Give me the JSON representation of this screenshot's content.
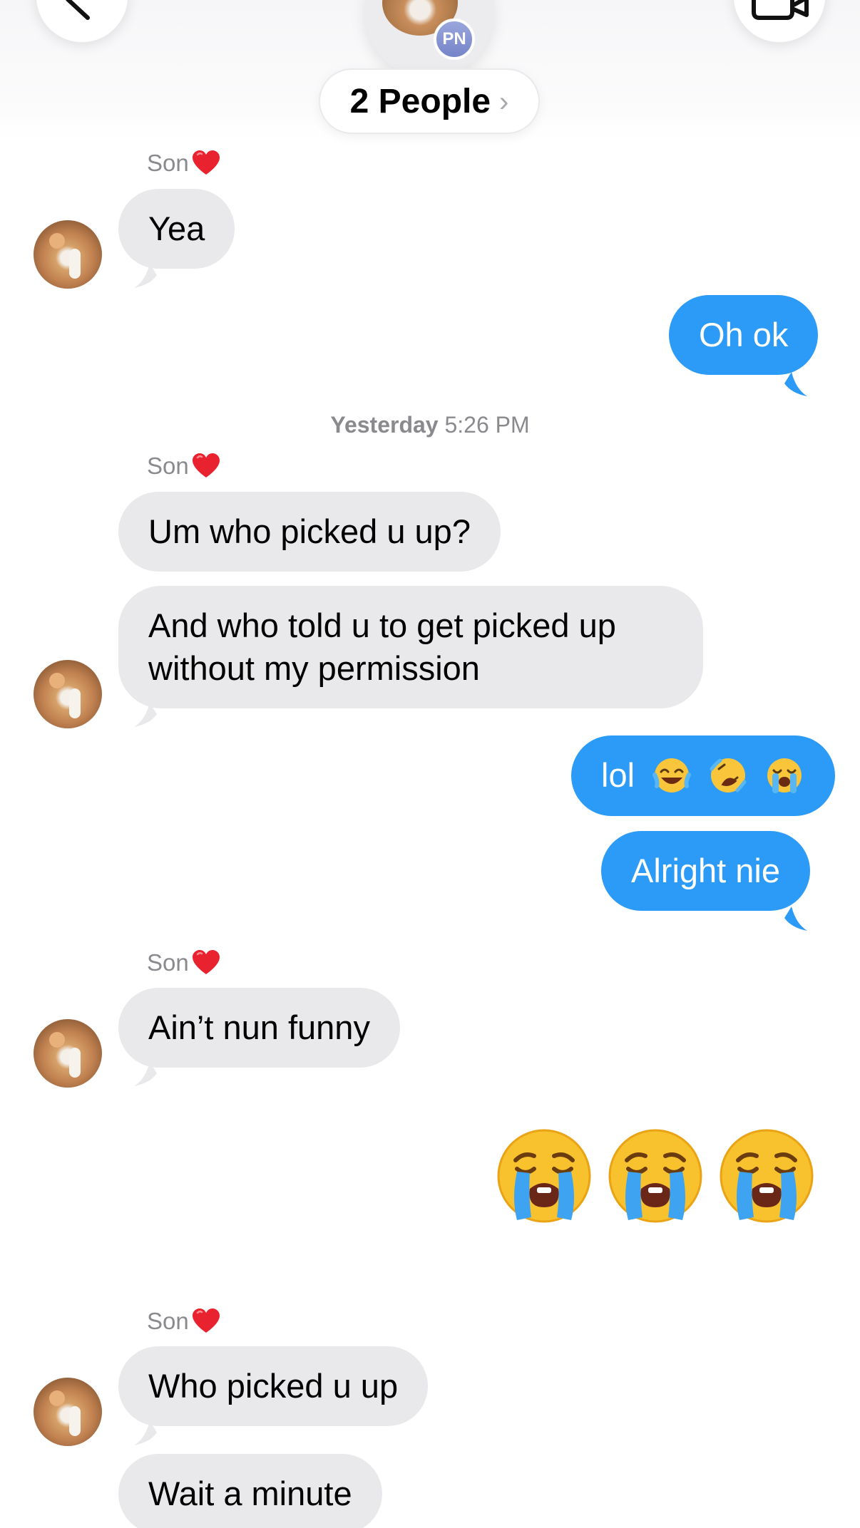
{
  "header": {
    "group_badge": "PN",
    "title": "2 People",
    "chevron": "›"
  },
  "icons": {
    "back": "chevron-left-icon",
    "video": "video-camera-icon",
    "heart": "red-heart-emoji",
    "crying": "loudly-crying-face-emoji",
    "joy": "face-with-tears-of-joy-emoji",
    "rofl": "rolling-on-floor-laughing-emoji"
  },
  "colors": {
    "outgoing_bubble": "#2c9bf7",
    "incoming_bubble": "#e9e9eb",
    "heart": "#e8232f"
  },
  "conversation": {
    "sender_name": "Son",
    "m1": "Yea",
    "m2": "Oh ok",
    "timestamp_day": "Yesterday",
    "timestamp_time": "5:26 PM",
    "m3": "Um who picked u up?",
    "m4": "And who told u to get picked up without my permission",
    "m5": "lol",
    "m6": "Alright nie",
    "m7": "Ain’t nun funny",
    "m9": "Who picked u up",
    "m10": "Wait a minute"
  }
}
